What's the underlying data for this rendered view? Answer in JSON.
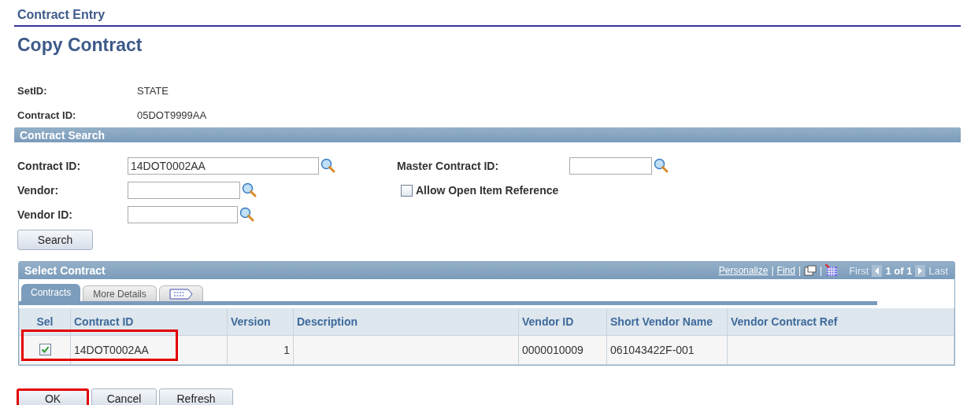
{
  "breadcrumb": "Contract Entry",
  "title": "Copy Contract",
  "info": [
    {
      "label": "SetID:",
      "value": "STATE"
    },
    {
      "label": "Contract ID:",
      "value": "05DOT9999AA"
    }
  ],
  "search_section": {
    "title": "Contract Search",
    "left_fields": [
      {
        "label": "Contract ID:",
        "value": "14DOT0002AA"
      },
      {
        "label": "Vendor:"
      },
      {
        "label": "Vendor ID:"
      }
    ],
    "master_field": {
      "label": "Master Contract ID:"
    },
    "allow_open_item": {
      "label": "Allow Open Item Reference",
      "checked": false
    },
    "search_button": "Search"
  },
  "grid": {
    "title": "Select Contract",
    "links": [
      "Personalize",
      "Find"
    ],
    "separators": [
      "|",
      "|",
      "|"
    ],
    "nav": {
      "first": "First",
      "first_disabled": true,
      "count": "1 of 1",
      "last": "Last",
      "last_disabled": true
    },
    "tabs": [
      {
        "kind": "text",
        "label": "Contracts",
        "selected": true
      },
      {
        "kind": "text",
        "label": "More Details",
        "selected": false
      },
      {
        "kind": "icon",
        "selected": false
      }
    ],
    "columns": [
      "Sel",
      "Contract ID",
      "Version",
      "Description",
      "Vendor ID",
      "Short Vendor Name",
      "Vendor Contract Ref"
    ],
    "rows": [
      {
        "checked": true,
        "highlighted": true,
        "contract_id": "14DOT0002AA",
        "version": "1",
        "description": "",
        "vendor_id": "0000010009",
        "short_vendor_name": "061043422F-001",
        "vendor_contract_ref": ""
      }
    ]
  },
  "buttons": [
    {
      "label": "OK",
      "highlighted": true
    },
    {
      "label": "Cancel",
      "highlighted": false
    },
    {
      "label": "Refresh",
      "highlighted": false
    }
  ]
}
